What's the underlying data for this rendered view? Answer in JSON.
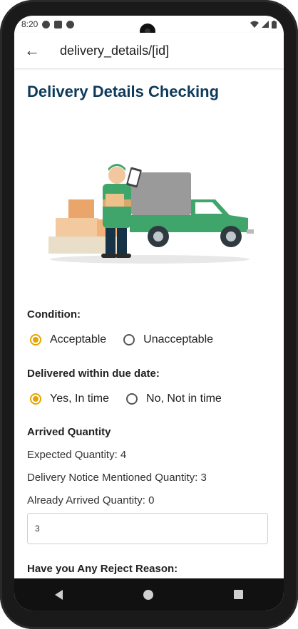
{
  "status": {
    "time": "8:20"
  },
  "appbar": {
    "title": "delivery_details/[id]"
  },
  "page": {
    "heading": "Delivery Details Checking"
  },
  "condition": {
    "label": "Condition:",
    "options": [
      {
        "label": "Acceptable",
        "selected": true
      },
      {
        "label": "Unacceptable",
        "selected": false
      }
    ]
  },
  "due_date": {
    "label": "Delivered within due date:",
    "options": [
      {
        "label": "Yes, In time",
        "selected": true
      },
      {
        "label": "No, Not in time",
        "selected": false
      }
    ]
  },
  "arrived": {
    "label": "Arrived Quantity",
    "expected": "Expected Quantity: 4",
    "notice": "Delivery Notice Mentioned Quantity: 3",
    "already": "Already Arrived Quantity: 0",
    "input_value": "3"
  },
  "reject": {
    "label": "Have you Any Reject Reason:"
  },
  "colors": {
    "accent": "#e5a500",
    "heading": "#0e3a5a"
  }
}
